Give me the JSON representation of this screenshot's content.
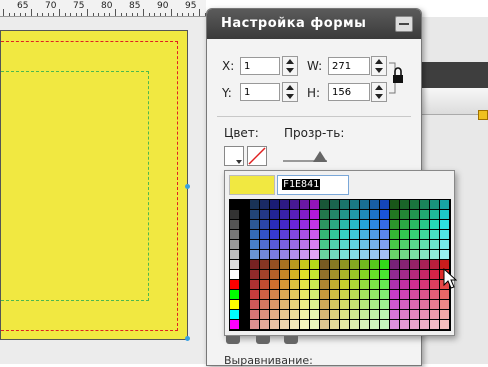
{
  "ruler": {
    "ticks": [
      "65",
      "70",
      "75",
      "80",
      "85",
      "90",
      "95"
    ]
  },
  "panel": {
    "title": "Настройка  формы",
    "x_label": "X:",
    "x_value": "1",
    "y_label": "Y:",
    "y_value": "1",
    "w_label": "W:",
    "w_value": "271",
    "h_label": "H:",
    "h_value": "156",
    "color_label": "Цвет:",
    "opacity_label": "Прозр-ть:",
    "opacity_value": 0.85,
    "bottom_label": "Выравнивание:"
  },
  "color_picker": {
    "preview_color": "#F1E841",
    "hex_value": "F1E841"
  },
  "colors": {
    "shape_fill": "#f1e841",
    "panel_header": "#3a3a3a",
    "dash_red": "#e02020",
    "dash_green": "#4db84d"
  }
}
